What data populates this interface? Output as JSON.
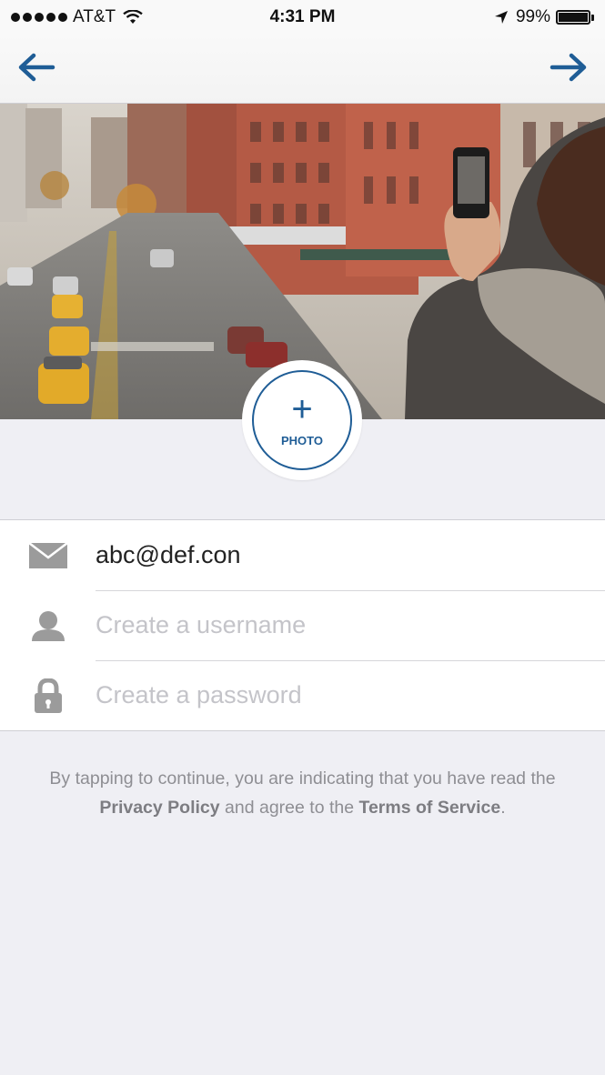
{
  "status_bar": {
    "carrier": "AT&T",
    "time": "4:31 PM",
    "battery_percent": "99%",
    "battery_level": 0.99
  },
  "nav": {
    "back_icon": "arrow-left-icon",
    "next_icon": "arrow-right-icon",
    "accent_color": "#1f5d96"
  },
  "photo_button": {
    "label": "PHOTO",
    "symbol": "+"
  },
  "form": {
    "email": {
      "icon": "mail-icon",
      "value": "abc@def.con",
      "placeholder": ""
    },
    "username": {
      "icon": "user-icon",
      "value": "",
      "placeholder": "Create a username"
    },
    "password": {
      "icon": "lock-icon",
      "value": "",
      "placeholder": "Create a password"
    }
  },
  "terms": {
    "part1": "By tapping to continue, you are indicating that you have read the ",
    "privacy_link": "Privacy Policy",
    "part2": " and agree to the ",
    "tos_link": "Terms of Service",
    "part3": "."
  }
}
